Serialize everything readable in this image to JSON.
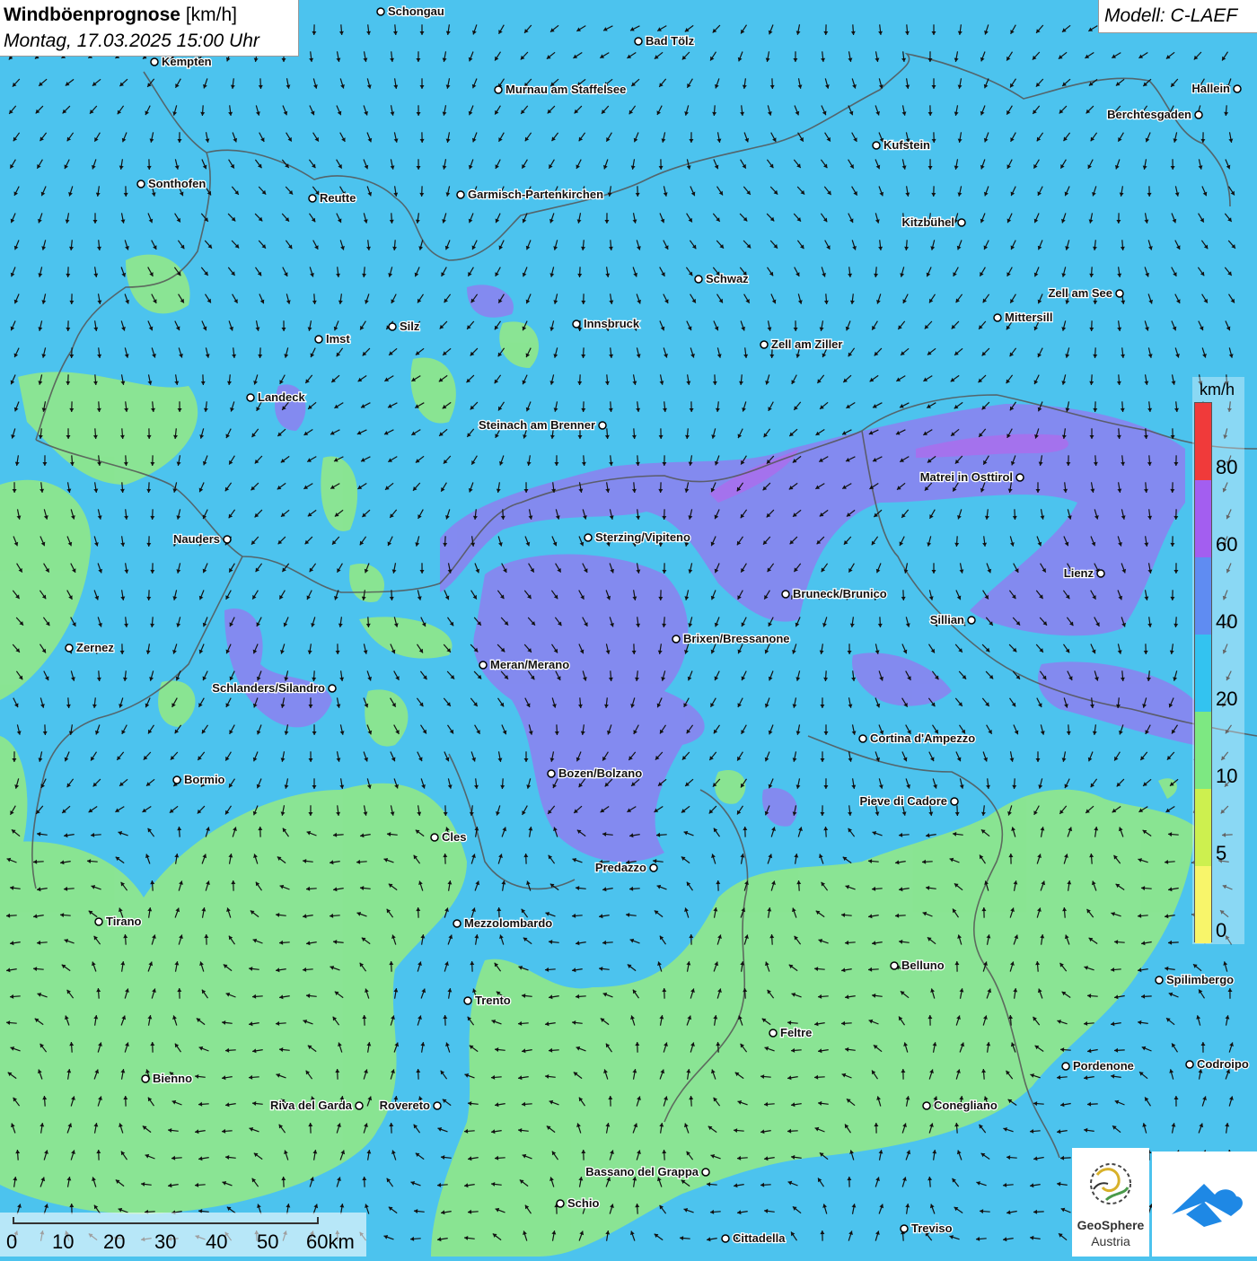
{
  "header": {
    "title": "Windböenprognose",
    "unit": "[km/h]",
    "date": "Montag, 17.03.2025 15:00 Uhr"
  },
  "model": "Modell: C-LAEF",
  "legend": {
    "unit": "km/h",
    "labels": [
      "80",
      "60",
      "40",
      "20",
      "10",
      "5",
      "0"
    ],
    "colors": [
      "#f03a3a",
      "#a35ef0",
      "#5f8cf2",
      "#33c3f0",
      "#7de882",
      "#cdf04f",
      "#f8f56a"
    ]
  },
  "scale": {
    "labels": [
      "0",
      "10",
      "20",
      "30",
      "40",
      "50",
      "60km"
    ]
  },
  "logo": {
    "line1": "GeoSphere",
    "line2": "Austria"
  },
  "colors": {
    "sea_blue": "#4cc3ee",
    "calm_green": "#8de68e",
    "purple": "#8a84f0",
    "strong_purple": "#a76fec"
  },
  "cities": [
    {
      "name": "Schongau"
    },
    {
      "name": "Bad Tölz"
    },
    {
      "name": "Kempten"
    },
    {
      "name": "Murnau am Staffelsee"
    },
    {
      "name": "Hallein"
    },
    {
      "name": "Berchtesgaden"
    },
    {
      "name": "Kufstein"
    },
    {
      "name": "Sonthofen"
    },
    {
      "name": "Reutte"
    },
    {
      "name": "Garmisch-Partenkirchen"
    },
    {
      "name": "Kitzbühel"
    },
    {
      "name": "Schwaz"
    },
    {
      "name": "Zell am See"
    },
    {
      "name": "Mittersill"
    },
    {
      "name": "Innsbruck"
    },
    {
      "name": "Imst"
    },
    {
      "name": "Silz"
    },
    {
      "name": "Zell am Ziller"
    },
    {
      "name": "Landeck"
    },
    {
      "name": "Steinach am Brenner"
    },
    {
      "name": "Matrei in Osttirol"
    },
    {
      "name": "Nauders"
    },
    {
      "name": "Sterzing/Vipiteno"
    },
    {
      "name": "Lienz"
    },
    {
      "name": "Bruneck/Brunico"
    },
    {
      "name": "Sillian"
    },
    {
      "name": "Zernez"
    },
    {
      "name": "Brixen/Bressanone"
    },
    {
      "name": "Meran/Merano"
    },
    {
      "name": "Schlanders/Silandro"
    },
    {
      "name": "Cortina d'Ampezzo"
    },
    {
      "name": "Bozen/Bolzano"
    },
    {
      "name": "Bormio"
    },
    {
      "name": "Pieve di Cadore"
    },
    {
      "name": "Cles"
    },
    {
      "name": "Predazzo"
    },
    {
      "name": "Tirano"
    },
    {
      "name": "Mezzolombardo"
    },
    {
      "name": "Belluno"
    },
    {
      "name": "Spilimbergo"
    },
    {
      "name": "Trento"
    },
    {
      "name": "Feltre"
    },
    {
      "name": "Pordenone"
    },
    {
      "name": "Codroipo"
    },
    {
      "name": "Bienno"
    },
    {
      "name": "Riva del Garda"
    },
    {
      "name": "Rovereto"
    },
    {
      "name": "Conegliano"
    },
    {
      "name": "Bassano del Grappa"
    },
    {
      "name": "Schio"
    },
    {
      "name": "Treviso"
    },
    {
      "name": "Cittadella"
    }
  ]
}
